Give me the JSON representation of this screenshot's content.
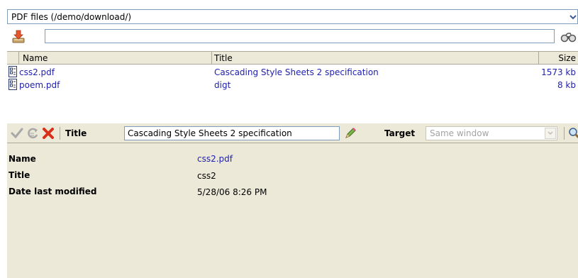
{
  "folder_select": {
    "value": "PDF files (/demo/download/)"
  },
  "filter_input": {
    "value": "",
    "placeholder": ""
  },
  "list": {
    "columns": {
      "name": "Name",
      "title": "Title",
      "size": "Size"
    },
    "rows": [
      {
        "name": "css2.pdf",
        "title": "Cascading Style Sheets 2 specification",
        "size": "1573 kb"
      },
      {
        "name": "poem.pdf",
        "title": "digt",
        "size": "8 kb"
      }
    ]
  },
  "edit_toolbar": {
    "title_label": "Title",
    "title_value": "Cascading Style Sheets 2 specification",
    "target_label": "Target",
    "target_value": "Same window"
  },
  "details": {
    "name_label": "Name",
    "name_value": "css2.pdf",
    "title_label": "Title",
    "title_value": "css2",
    "date_label": "Date last modified",
    "date_value": "5/28/06 8:26 PM"
  },
  "colors": {
    "link": "#2020b0",
    "panel_bg": "#ece9d8",
    "border": "#7f9db9"
  },
  "icons": [
    "chevron-down-icon",
    "download-icon",
    "binoculars-icon",
    "pdf-file-icon",
    "checkmark-icon",
    "refresh-icon",
    "delete-icon",
    "pencil-icon",
    "magnifier-icon"
  ]
}
